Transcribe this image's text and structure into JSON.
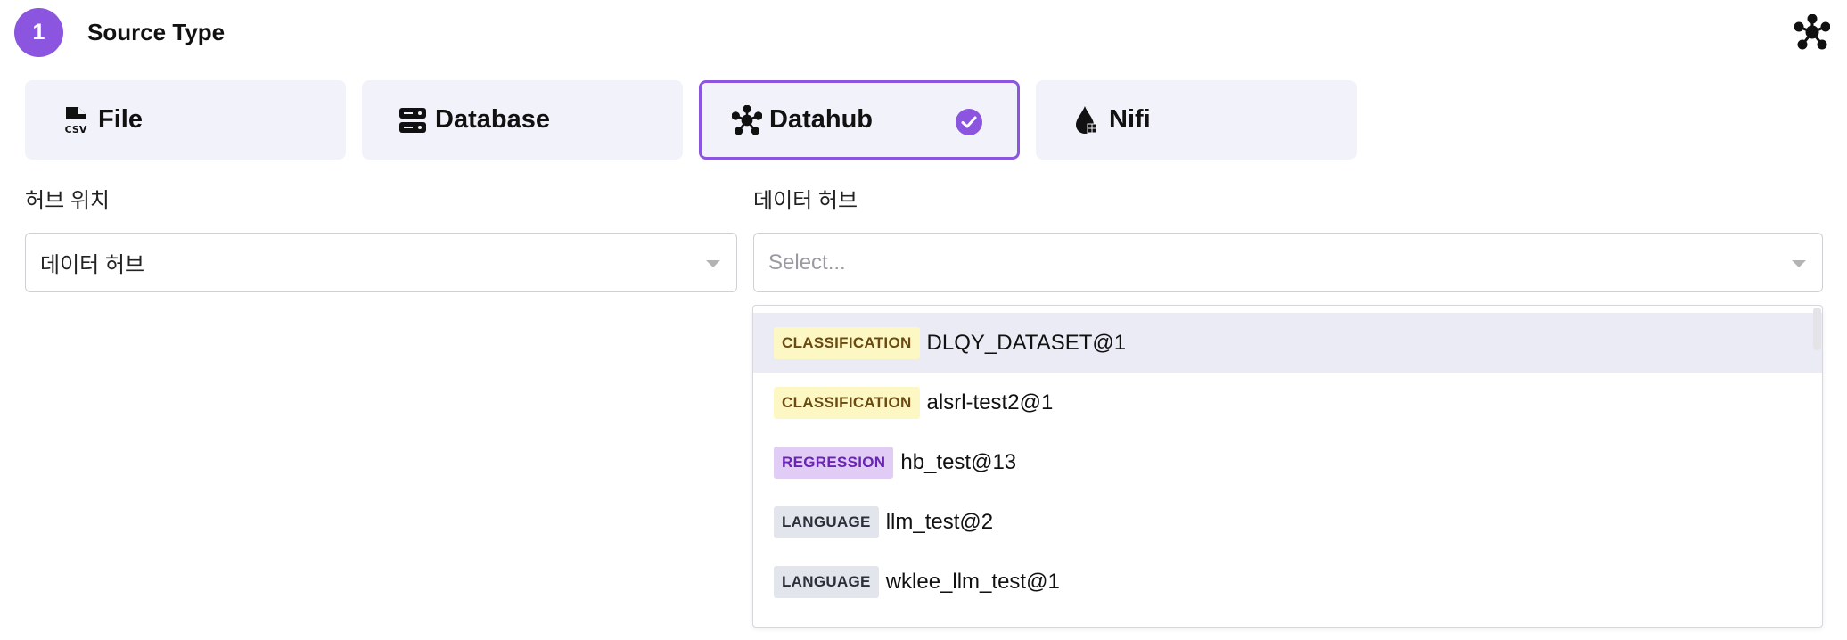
{
  "step": {
    "number": "1",
    "title": "Source Type"
  },
  "source_types": [
    {
      "label": "File",
      "icon": "csv-file-icon",
      "selected": false
    },
    {
      "label": "Database",
      "icon": "database-icon",
      "selected": false
    },
    {
      "label": "Datahub",
      "icon": "datahub-icon",
      "selected": true
    },
    {
      "label": "Nifi",
      "icon": "nifi-drop-icon",
      "selected": false
    }
  ],
  "hub_location": {
    "label": "허브 위치",
    "value": "데이터 허브"
  },
  "data_hub": {
    "label": "데이터 허브",
    "placeholder": "Select..."
  },
  "dropdown_options": [
    {
      "tag": "CLASSIFICATION",
      "name": "DLQY_DATASET@1"
    },
    {
      "tag": "CLASSIFICATION",
      "name": "alsrl-test2@1"
    },
    {
      "tag": "REGRESSION",
      "name": "hb_test@13"
    },
    {
      "tag": "LANGUAGE",
      "name": "llm_test@2"
    },
    {
      "tag": "LANGUAGE",
      "name": "wklee_llm_test@1"
    }
  ],
  "colors": {
    "accent": "#8b55e0",
    "card_bg": "#f2f2fb",
    "highlight_bg": "#ebebf6"
  }
}
